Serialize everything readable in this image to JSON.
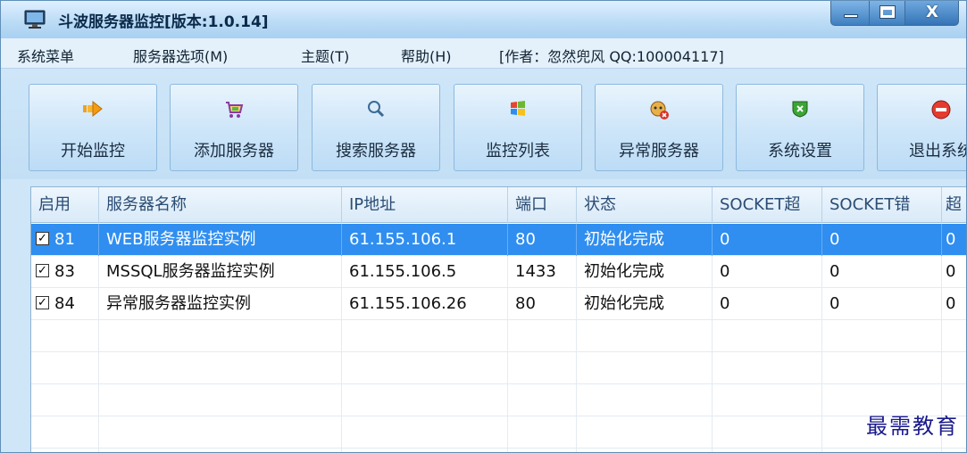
{
  "window": {
    "title": "斗波服务器监控[版本:1.0.14]",
    "close_glyph": "X"
  },
  "menu": {
    "items": [
      "系统菜单",
      "服务器选项(M)",
      "主题(T)",
      "帮助(H)",
      "[作者：忽然兜风 QQ:100004117]"
    ]
  },
  "toolbar": {
    "buttons": [
      {
        "label": "开始监控",
        "icon": "start-arrow-icon"
      },
      {
        "label": "添加服务器",
        "icon": "cart-add-icon"
      },
      {
        "label": "搜索服务器",
        "icon": "magnifier-icon"
      },
      {
        "label": "监控列表",
        "icon": "windows-flag-icon"
      },
      {
        "label": "异常服务器",
        "icon": "server-error-icon"
      },
      {
        "label": "系统设置",
        "icon": "settings-shield-icon"
      },
      {
        "label": "退出系统",
        "icon": "exit-stop-icon"
      }
    ]
  },
  "grid": {
    "columns": [
      "启用",
      "服务器名称",
      "IP地址",
      "端口",
      "状态",
      "SOCKET超",
      "SOCKET错",
      "超"
    ],
    "rows": [
      {
        "enabled": true,
        "id": "81",
        "name": "WEB服务器监控实例",
        "ip": "61.155.106.1",
        "port": "80",
        "status": "初始化完成",
        "socket_timeout": "0",
        "socket_error": "0",
        "extra": "0"
      },
      {
        "enabled": true,
        "id": "83",
        "name": "MSSQL服务器监控实例",
        "ip": "61.155.106.5",
        "port": "1433",
        "status": "初始化完成",
        "socket_timeout": "0",
        "socket_error": "0",
        "extra": "0"
      },
      {
        "enabled": true,
        "id": "84",
        "name": "异常服务器监控实例",
        "ip": "61.155.106.26",
        "port": "80",
        "status": "初始化完成",
        "socket_timeout": "0",
        "socket_error": "0",
        "extra": "0"
      }
    ],
    "selected_row": 0,
    "check_glyph": "✓"
  },
  "watermark": "最需教育",
  "colors": {
    "selection": "#2f8ef0",
    "titlebar": "#bcdcf6",
    "toolbar_bg": "#cfe6f8"
  }
}
